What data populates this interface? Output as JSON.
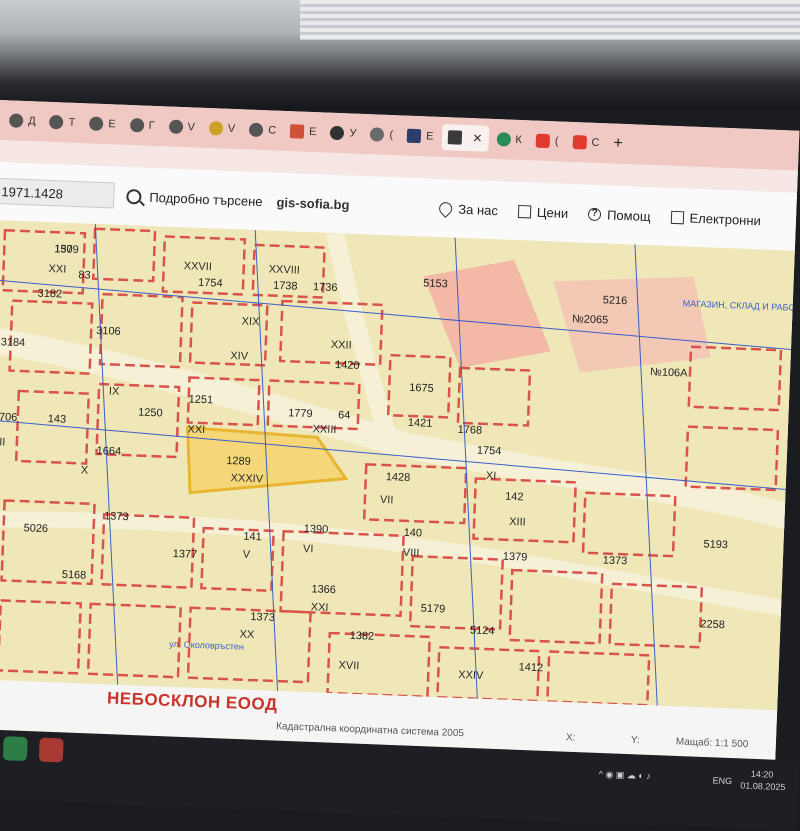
{
  "browser": {
    "tabs": [
      {
        "label": "Д",
        "icon": "site-icon"
      },
      {
        "label": "Т",
        "icon": "site-icon"
      },
      {
        "label": "Е",
        "icon": "site-icon"
      },
      {
        "label": "Г",
        "icon": "site-icon"
      },
      {
        "label": "V",
        "icon": "site-icon"
      },
      {
        "label": "V",
        "icon": "site-icon"
      },
      {
        "label": "С",
        "icon": "site-icon"
      },
      {
        "label": "Е",
        "icon": "site-icon"
      },
      {
        "label": "У",
        "icon": "site-icon"
      },
      {
        "label": "(",
        "icon": "site-icon"
      },
      {
        "label": "Е",
        "icon": "gis-icon"
      },
      {
        "label": "",
        "icon": "gis-icon",
        "active": true
      },
      {
        "label": "К",
        "icon": "site-icon"
      },
      {
        "label": "(",
        "icon": "youtube-icon"
      },
      {
        "label": "С",
        "icon": "youtube-icon"
      }
    ],
    "close_glyph": "✕",
    "new_tab_glyph": "+"
  },
  "header": {
    "coordinate_value": "1971.1428",
    "search_label": "Подробно търсене",
    "site_name": "gis-sofia.bg",
    "nav": [
      {
        "label": "За нас",
        "icon": "location-pin-icon"
      },
      {
        "label": "Цени",
        "icon": "price-list-icon"
      },
      {
        "label": "Помощ",
        "icon": "help-icon",
        "glyph": "?"
      },
      {
        "label": "Електронни",
        "icon": "external-link-icon"
      }
    ]
  },
  "map": {
    "colors": {
      "parcel_fill": "#efe7b8",
      "road": "#f6f1d6",
      "boundary": "#d9534a",
      "highlight": "#f2c83a",
      "line_blue": "#3a5fc9"
    },
    "labels": [
      {
        "t": "150"
      },
      {
        "t": "XXI"
      },
      {
        "t": "83"
      },
      {
        "t": "3182"
      },
      {
        "t": "XXVII"
      },
      {
        "t": "1754"
      },
      {
        "t": "XXVIII"
      },
      {
        "t": "1738"
      },
      {
        "t": "1736"
      },
      {
        "t": "5153"
      },
      {
        "t": "XIX"
      },
      {
        "t": "3106"
      },
      {
        "t": "3184"
      },
      {
        "t": "XXII"
      },
      {
        "t": "1420"
      },
      {
        "t": "XIV"
      },
      {
        "t": "1675"
      },
      {
        "t": "IX"
      },
      {
        "t": "1250"
      },
      {
        "t": "1251"
      },
      {
        "t": "XXI"
      },
      {
        "t": "1779"
      },
      {
        "t": "XXIII"
      },
      {
        "t": "64"
      },
      {
        "t": "1421"
      },
      {
        "t": "1768"
      },
      {
        "t": "1754"
      },
      {
        "t": "XI"
      },
      {
        "t": "143"
      },
      {
        "t": "1706"
      },
      {
        "t": "XII"
      },
      {
        "t": "1664"
      },
      {
        "t": "X"
      },
      {
        "t": "1289"
      },
      {
        "t": "XXXIV"
      },
      {
        "t": "1428"
      },
      {
        "t": "VII"
      },
      {
        "t": "142"
      },
      {
        "t": "XIII"
      },
      {
        "t": "1373"
      },
      {
        "t": "1390"
      },
      {
        "t": "VI"
      },
      {
        "t": "141"
      },
      {
        "t": "V"
      },
      {
        "t": "140"
      },
      {
        "t": "VIII"
      },
      {
        "t": "1379"
      },
      {
        "t": "1373"
      },
      {
        "t": "5193"
      },
      {
        "t": "5026"
      },
      {
        "t": "1366"
      },
      {
        "t": "XXI"
      },
      {
        "t": "1377"
      },
      {
        "t": "5168"
      },
      {
        "t": "5179"
      },
      {
        "t": "1373"
      },
      {
        "t": "XX"
      },
      {
        "t": "1382"
      },
      {
        "t": "5124"
      },
      {
        "t": "XXIV"
      },
      {
        "t": "1412"
      },
      {
        "t": "2258"
      },
      {
        "t": "5216"
      },
      {
        "t": "№106А"
      },
      {
        "t": "№2065"
      },
      {
        "t": "МАГАЗИН, СКЛАД И РАБОТИЛНИЦА"
      },
      {
        "t": "ул. Околовръстен"
      },
      {
        "t": "XVII"
      },
      {
        "t": "1379"
      }
    ]
  },
  "status": {
    "company": "НЕБОСКЛОН ЕООД",
    "crs": "Кадастрална координатна система 2005",
    "x_label": "X:",
    "y_label": "Y:",
    "scale": "Мащаб: 1:1 500"
  },
  "taskbar": {
    "lang": "ENG",
    "time": "14:20",
    "date": "01.08.2025"
  }
}
